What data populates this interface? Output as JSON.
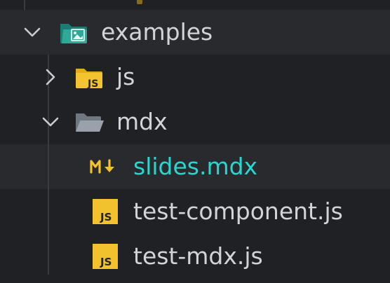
{
  "tree": {
    "items": [
      {
        "label": "examples",
        "icon": "folder-images-open-icon",
        "expanded": true
      },
      {
        "label": "js",
        "icon": "folder-js-icon",
        "expanded": false
      },
      {
        "label": "mdx",
        "icon": "folder-open-icon",
        "expanded": true
      },
      {
        "label": "slides.mdx",
        "icon": "markdown-icon",
        "selected": true
      },
      {
        "label": "test-component.js",
        "icon": "javascript-file-icon"
      },
      {
        "label": "test-mdx.js",
        "icon": "javascript-file-icon"
      }
    ]
  },
  "colors": {
    "background": "#1f2124",
    "selected_row": "#282a2e",
    "selected_text": "#28d7d0",
    "text": "#d2d4d8",
    "folder_teal": "#2f9b8e",
    "folder_yellow": "#f2c12e",
    "folder_gray": "#8c939c",
    "js_yellow": "#f2c12e",
    "md_yellow": "#f2c12e"
  }
}
